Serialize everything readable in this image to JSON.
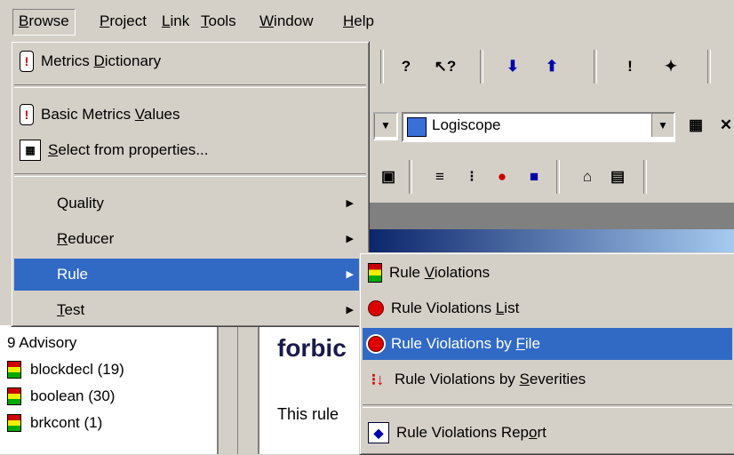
{
  "menubar": {
    "items": [
      "Browse",
      "Project",
      "Link",
      "Tools",
      "Window",
      "Help"
    ],
    "browse_access": "B",
    "browse_rest": "rowse",
    "project_access": "P",
    "project_rest": "roject",
    "link_access": "L",
    "link_rest": "ink",
    "tools_access": "T",
    "tools_rest": "ools",
    "window_access": "W",
    "window_rest": "indow",
    "help_access": "H",
    "help_rest": "elp"
  },
  "toolbar": {
    "combo_text": "Logiscope"
  },
  "browse_menu": {
    "metrics_dictionary": {
      "pre": "Metrics ",
      "acc": "D",
      "post": "ictionary"
    },
    "basic_metrics_values": {
      "pre": "Basic Metrics ",
      "acc": "V",
      "post": "alues"
    },
    "select_from_properties": {
      "pre": "",
      "acc": "S",
      "post": "elect from properties..."
    },
    "quality": {
      "pre": "",
      "acc": "",
      "post": "Quality"
    },
    "reducer": {
      "pre": "",
      "acc": "R",
      "post": "educer"
    },
    "rule": {
      "pre": "",
      "acc": "",
      "post": "Rule"
    },
    "test": {
      "pre": "",
      "acc": "T",
      "post": "est"
    }
  },
  "rule_submenu": {
    "rule_violations": {
      "pre": "Rule ",
      "acc": "V",
      "post": "iolations"
    },
    "rule_violations_list": {
      "pre": "Rule Violations ",
      "acc": "L",
      "post": "ist"
    },
    "rule_violations_by_file": {
      "pre": "Rule Violations by ",
      "acc": "F",
      "post": "ile"
    },
    "rule_violations_by_severities": {
      "pre": "Rule Violations by ",
      "acc": "S",
      "post": "everities"
    },
    "rule_violations_report": {
      "pre": "Rule Violations Rep",
      "acc": "o",
      "post": "rt"
    }
  },
  "left_pane": {
    "header": "9 Advisory",
    "items": [
      "blockdecl (19)",
      "boolean (30)",
      "brkcont (1)"
    ]
  },
  "content": {
    "heading": "forbic",
    "text": "This rule"
  },
  "colors": {
    "menu_bg": "#d4d0c8",
    "highlight": "#316ac5"
  }
}
